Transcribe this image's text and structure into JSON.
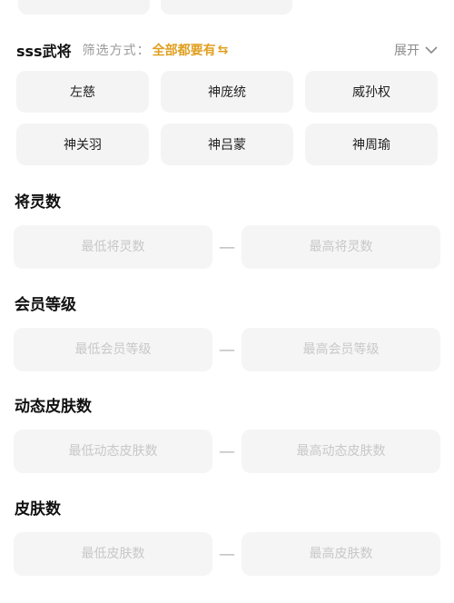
{
  "filter": {
    "title": "sss武将",
    "label": "筛选方式：",
    "mode": "全部都要有",
    "mode_icon": "swap-arrows-icon",
    "expand_label": "展开"
  },
  "generals": [
    "左慈",
    "神庞统",
    "威孙权",
    "神关羽",
    "神吕蒙",
    "神周瑜"
  ],
  "sections": [
    {
      "title": "将灵数",
      "min_placeholder": "最低将灵数",
      "max_placeholder": "最高将灵数",
      "separator": "—"
    },
    {
      "title": "会员等级",
      "min_placeholder": "最低会员等级",
      "max_placeholder": "最高会员等级",
      "separator": "—"
    },
    {
      "title": "动态皮肤数",
      "min_placeholder": "最低动态皮肤数",
      "max_placeholder": "最高动态皮肤数",
      "separator": "—"
    },
    {
      "title": "皮肤数",
      "min_placeholder": "最低皮肤数",
      "max_placeholder": "最高皮肤数",
      "separator": "—"
    }
  ],
  "colors": {
    "accent": "#e0a020",
    "chip_bg": "#f4f4f4",
    "placeholder": "#c8c8c8"
  }
}
